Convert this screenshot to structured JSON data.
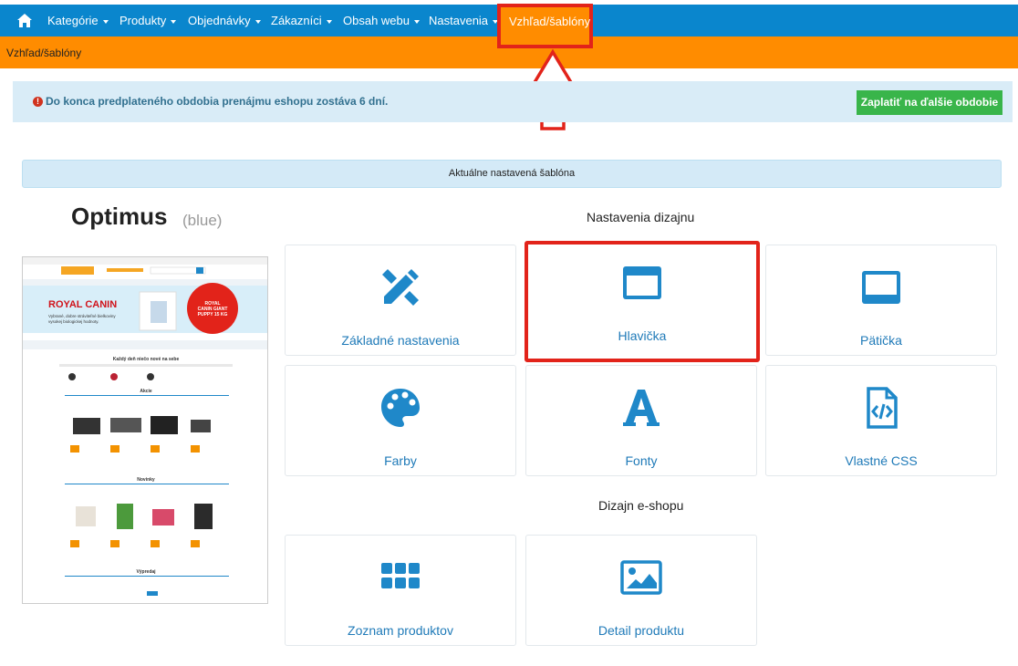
{
  "nav": {
    "home_icon": "home-icon",
    "items": [
      {
        "label": "Kategórie",
        "dropdown": true
      },
      {
        "label": "Produkty",
        "dropdown": true
      },
      {
        "label": "Objednávky",
        "dropdown": true
      },
      {
        "label": "Zákazníci",
        "dropdown": true
      },
      {
        "label": "Obsah webu",
        "dropdown": true
      },
      {
        "label": "Nastavenia",
        "dropdown": true
      }
    ],
    "active_label": "Vzhľad/šablóny"
  },
  "breadcrumb": "Vzhľad/šablóny",
  "alert": {
    "icon": "exclamation-circle-icon",
    "message": "Do konca predplateného obdobia prenájmu eshopu zostáva 6 dní.",
    "button": "Zaplatiť na ďalšie obdobie"
  },
  "current_template": {
    "header": "Aktuálne nastavená šablóna",
    "name": "Optimus",
    "variant": "(blue)"
  },
  "preview": {
    "brand": "ROYAL CANIN",
    "banner_text": "Vybrané, dobre stráviteľné bielkoviny vysokej biologickej hodnoty.",
    "badge": "ROYAL CANIN GIANT PUPPY 15 KG",
    "headline": "Každý deň niečo nové na sebe",
    "sections": [
      "Akcie",
      "Novinky",
      "Výpredaj"
    ]
  },
  "design_settings": {
    "title": "Nastavenia dizajnu",
    "tiles": [
      {
        "label": "Základné nastavenia",
        "icon": "tools-icon"
      },
      {
        "label": "Hlavička",
        "icon": "window-header-icon"
      },
      {
        "label": "Pätička",
        "icon": "window-footer-icon"
      },
      {
        "label": "Farby",
        "icon": "palette-icon"
      },
      {
        "label": "Fonty",
        "icon": "font-icon"
      },
      {
        "label": "Vlastné CSS",
        "icon": "code-file-icon"
      }
    ]
  },
  "eshop_design": {
    "title": "Dizajn e-shopu",
    "tiles": [
      {
        "label": "Zoznam produktov",
        "icon": "grid-icon"
      },
      {
        "label": "Detail produktu",
        "icon": "image-icon"
      }
    ]
  },
  "colors": {
    "nav_blue": "#0a86cd",
    "accent_orange": "#ff8c00",
    "highlight_red": "#e2231a",
    "icon_blue": "#1f88c9",
    "pay_green": "#39b54a"
  }
}
